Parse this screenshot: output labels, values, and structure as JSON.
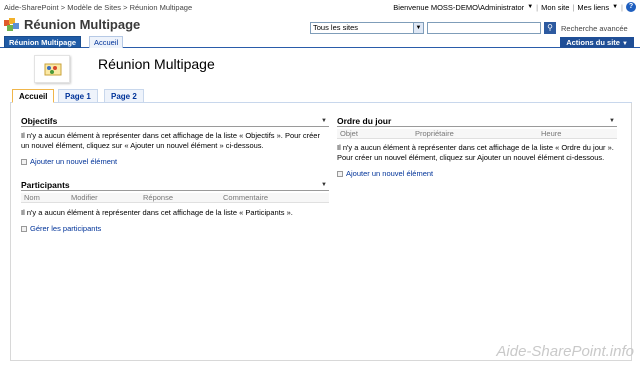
{
  "breadcrumb": {
    "items": [
      "Aide-SharePoint",
      "Modèle de Sites",
      "Réunion Multipage"
    ],
    "separator": ">"
  },
  "toplinks": {
    "welcome": "Bienvenue MOSS-DEMO\\Administrator",
    "mysite": "Mon site",
    "mylinks": "Mes liens",
    "separator": "|"
  },
  "site": {
    "title": "Réunion Multipage"
  },
  "search": {
    "scope": "Tous les sites",
    "query": "",
    "advanced": "Recherche avancée"
  },
  "nav": {
    "tabs": [
      {
        "label": "Réunion Multipage",
        "active": true
      },
      {
        "label": "Accueil",
        "active": false
      }
    ],
    "actions": "Actions du site"
  },
  "page": {
    "title": "Réunion Multipage",
    "tabs": [
      "Accueil",
      "Page 1",
      "Page 2"
    ]
  },
  "objectifs": {
    "title": "Objectifs",
    "empty_text": "Il n'y a aucun élément à représenter dans cet affichage de la liste « Objectifs ». Pour créer un nouvel élément, cliquez sur « Ajouter un nouvel élément » ci-dessous.",
    "add_link": "Ajouter un nouvel élément"
  },
  "participants": {
    "title": "Participants",
    "columns": [
      "Nom",
      "Modifier",
      "Réponse",
      "Commentaire"
    ],
    "empty_text": "Il n'y a aucun élément à représenter dans cet affichage de la liste « Participants ».",
    "manage_link": "Gérer les participants"
  },
  "ordre": {
    "title": "Ordre du jour",
    "columns": [
      "Objet",
      "Propriétaire",
      "Heure"
    ],
    "empty_text": "Il n'y a aucun élément à représenter dans cet affichage de la liste « Ordre du jour ». Pour créer un nouvel élément, cliquez sur Ajouter un nouvel élément ci-dessous.",
    "add_link": "Ajouter un nouvel élément"
  },
  "watermark": "Aide-SharePoint.info",
  "icons": {
    "logo": "sharepoint-logo-icon",
    "page": "meeting-icon",
    "menu": "chevron-down-icon",
    "search": "search-icon",
    "help": "help-icon"
  },
  "colors": {
    "nav_active": "#1f5ba6",
    "actions": "#1f4e96",
    "link": "#003399",
    "tab_active_border": "#f0b64b"
  }
}
